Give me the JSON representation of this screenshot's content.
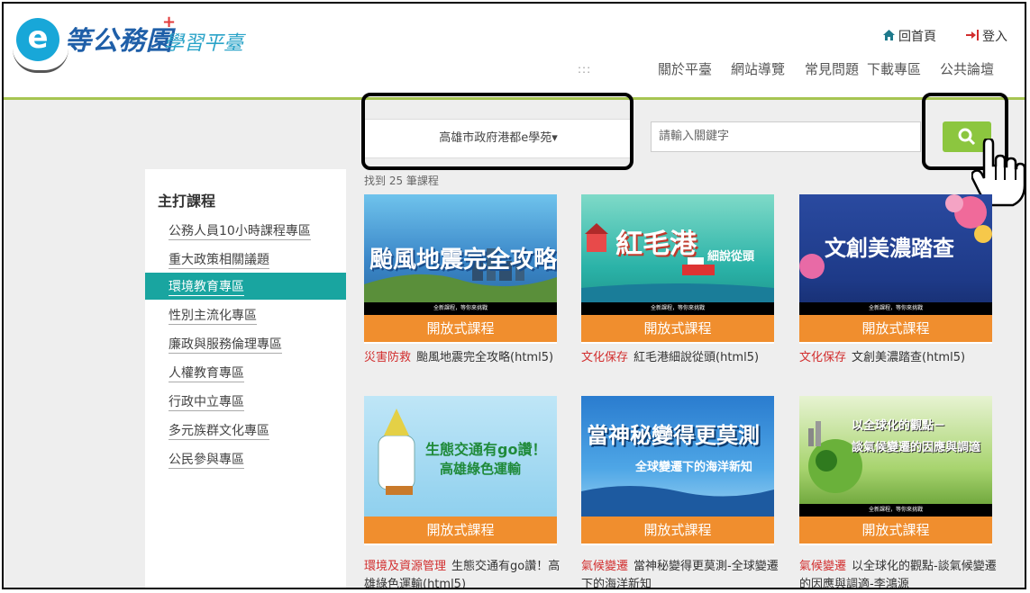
{
  "logo": {
    "letter": "e",
    "title": "等公務園",
    "plus": "+",
    "subtitle": "學習平臺"
  },
  "top_links": {
    "home": "回首頁",
    "login": "登入"
  },
  "nav": {
    "dots": ":::",
    "items": [
      "關於平臺",
      "網站導覽",
      "常見問題",
      "下載專區",
      "公共論壇"
    ]
  },
  "search": {
    "school": "高雄市政府港都e學苑▾",
    "placeholder": "請輸入關鍵字"
  },
  "results_count": "找到 25 筆課程",
  "sidebar": {
    "title": "主打課程",
    "items": [
      "公務人員10小時課程專區",
      "重大政策相關議題",
      "環境教育專區",
      "性別主流化專區",
      "廉政與服務倫理專區",
      "人權教育專區",
      "行政中立專區",
      "多元族群文化專區",
      "公民參與專區"
    ],
    "active_index": 2
  },
  "courses": [
    {
      "tag": "災害防救",
      "title": "颱風地震完全攻略(html5)",
      "band": "開放式課程",
      "img_text": "颱風地震完全攻略",
      "cap": "全新課程，等你來挑戰"
    },
    {
      "tag": "文化保存",
      "title": "紅毛港細說從頭(html5)",
      "band": "開放式課程",
      "img_text": "紅毛港",
      "img_sub": "細說從頭",
      "cap": "全新課程，等你來挑戰"
    },
    {
      "tag": "文化保存",
      "title": "文創美濃踏查(html5)",
      "band": "開放式課程",
      "img_text": "文創美濃踏查",
      "cap": "全新課程，等你來挑戰"
    },
    {
      "tag": "環境及資源管理",
      "title": "生態交通有go讚！高雄綠色運輸(html5)",
      "band": "開放式課程",
      "img_text": "生態交通有go讚！",
      "img_sub": "高雄綠色運輸"
    },
    {
      "tag": "氣候變遷",
      "title": "當神秘變得更莫測-全球變遷下的海洋新知",
      "band": "開放式課程",
      "img_text": "當神秘變得更莫測",
      "img_sub": "全球變遷下的海洋新知"
    },
    {
      "tag": "氣候變遷",
      "title": "以全球化的觀點-談氣候變遷的因應與調適-李鴻源",
      "band": "開放式課程",
      "img_text": "以全球化的觀點－",
      "img_sub": "談氣候變遷的因應與調適",
      "cap": "全新課程，等你來挑戰"
    }
  ],
  "colors": {
    "accent_green": "#8cc63f",
    "active_teal": "#19a5a0",
    "band_orange": "#f08e2e",
    "tag_red": "#d22d2d",
    "header_line": "#a6c552"
  },
  "icons": [
    "home-icon",
    "login-icon",
    "search-icon",
    "hand-cursor-icon"
  ]
}
